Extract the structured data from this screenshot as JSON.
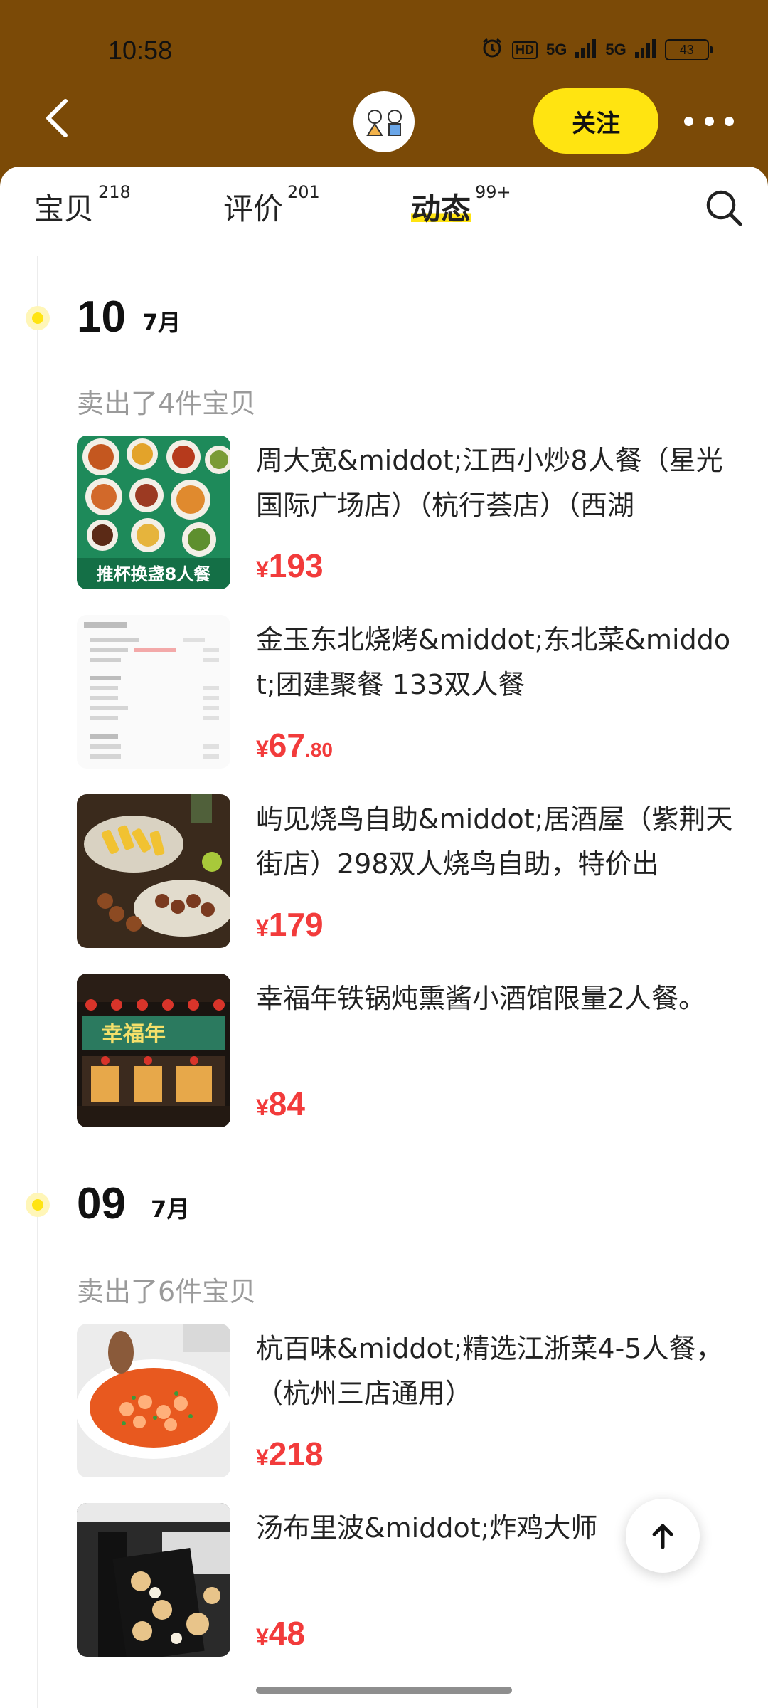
{
  "status_bar": {
    "time": "10:58",
    "hd": "HD",
    "signal_1": "5G",
    "signal_2": "5G",
    "battery": "43"
  },
  "header": {
    "follow_label": "关注"
  },
  "tabs": [
    {
      "label": "宝贝",
      "count": "218"
    },
    {
      "label": "评价",
      "count": "201"
    },
    {
      "label": "动态",
      "count": "99+"
    }
  ],
  "groups": [
    {
      "day": "10",
      "month": "7月",
      "sold_text": "卖出了4件宝贝",
      "items": [
        {
          "title": "周大宽&middot;江西小炒8人餐（星光国际广场店）（杭行荟店）（西湖",
          "price_int": "193",
          "price_dec": "",
          "thumb_caption": "推杯换盏8人餐"
        },
        {
          "title": "金玉东北烧烤&middot;东北菜&middot;团建聚餐 133双人餐",
          "price_int": "67",
          "price_dec": ".80",
          "thumb_caption": ""
        },
        {
          "title": "屿见烧鸟自助&middot;居酒屋（紫荆天街店）298双人烧鸟自助，特价出",
          "price_int": "179",
          "price_dec": "",
          "thumb_caption": ""
        },
        {
          "title": "幸福年铁锅炖熏酱小酒馆限量2人餐。",
          "price_int": "84",
          "price_dec": "",
          "thumb_caption": "幸福年"
        }
      ]
    },
    {
      "day": "09",
      "month": "7月",
      "sold_text": "卖出了6件宝贝",
      "items": [
        {
          "title": "杭百味&middot;精选江浙菜4-5人餐，（杭州三店通用）",
          "price_int": "218",
          "price_dec": "",
          "thumb_caption": ""
        },
        {
          "title": "汤布里波&middot;炸鸡大师",
          "price_int": "48",
          "price_dec": "",
          "thumb_caption": ""
        }
      ]
    }
  ],
  "currency": "¥",
  "colors": {
    "header_bg": "#7b4a07",
    "accent_yellow": "#ffe411",
    "price_red": "#f23b3b"
  },
  "icons": [
    "back-arrow-icon",
    "avatar-icon",
    "more-dots-icon",
    "search-icon",
    "back-to-top-icon",
    "alarm-icon",
    "battery-icon"
  ]
}
